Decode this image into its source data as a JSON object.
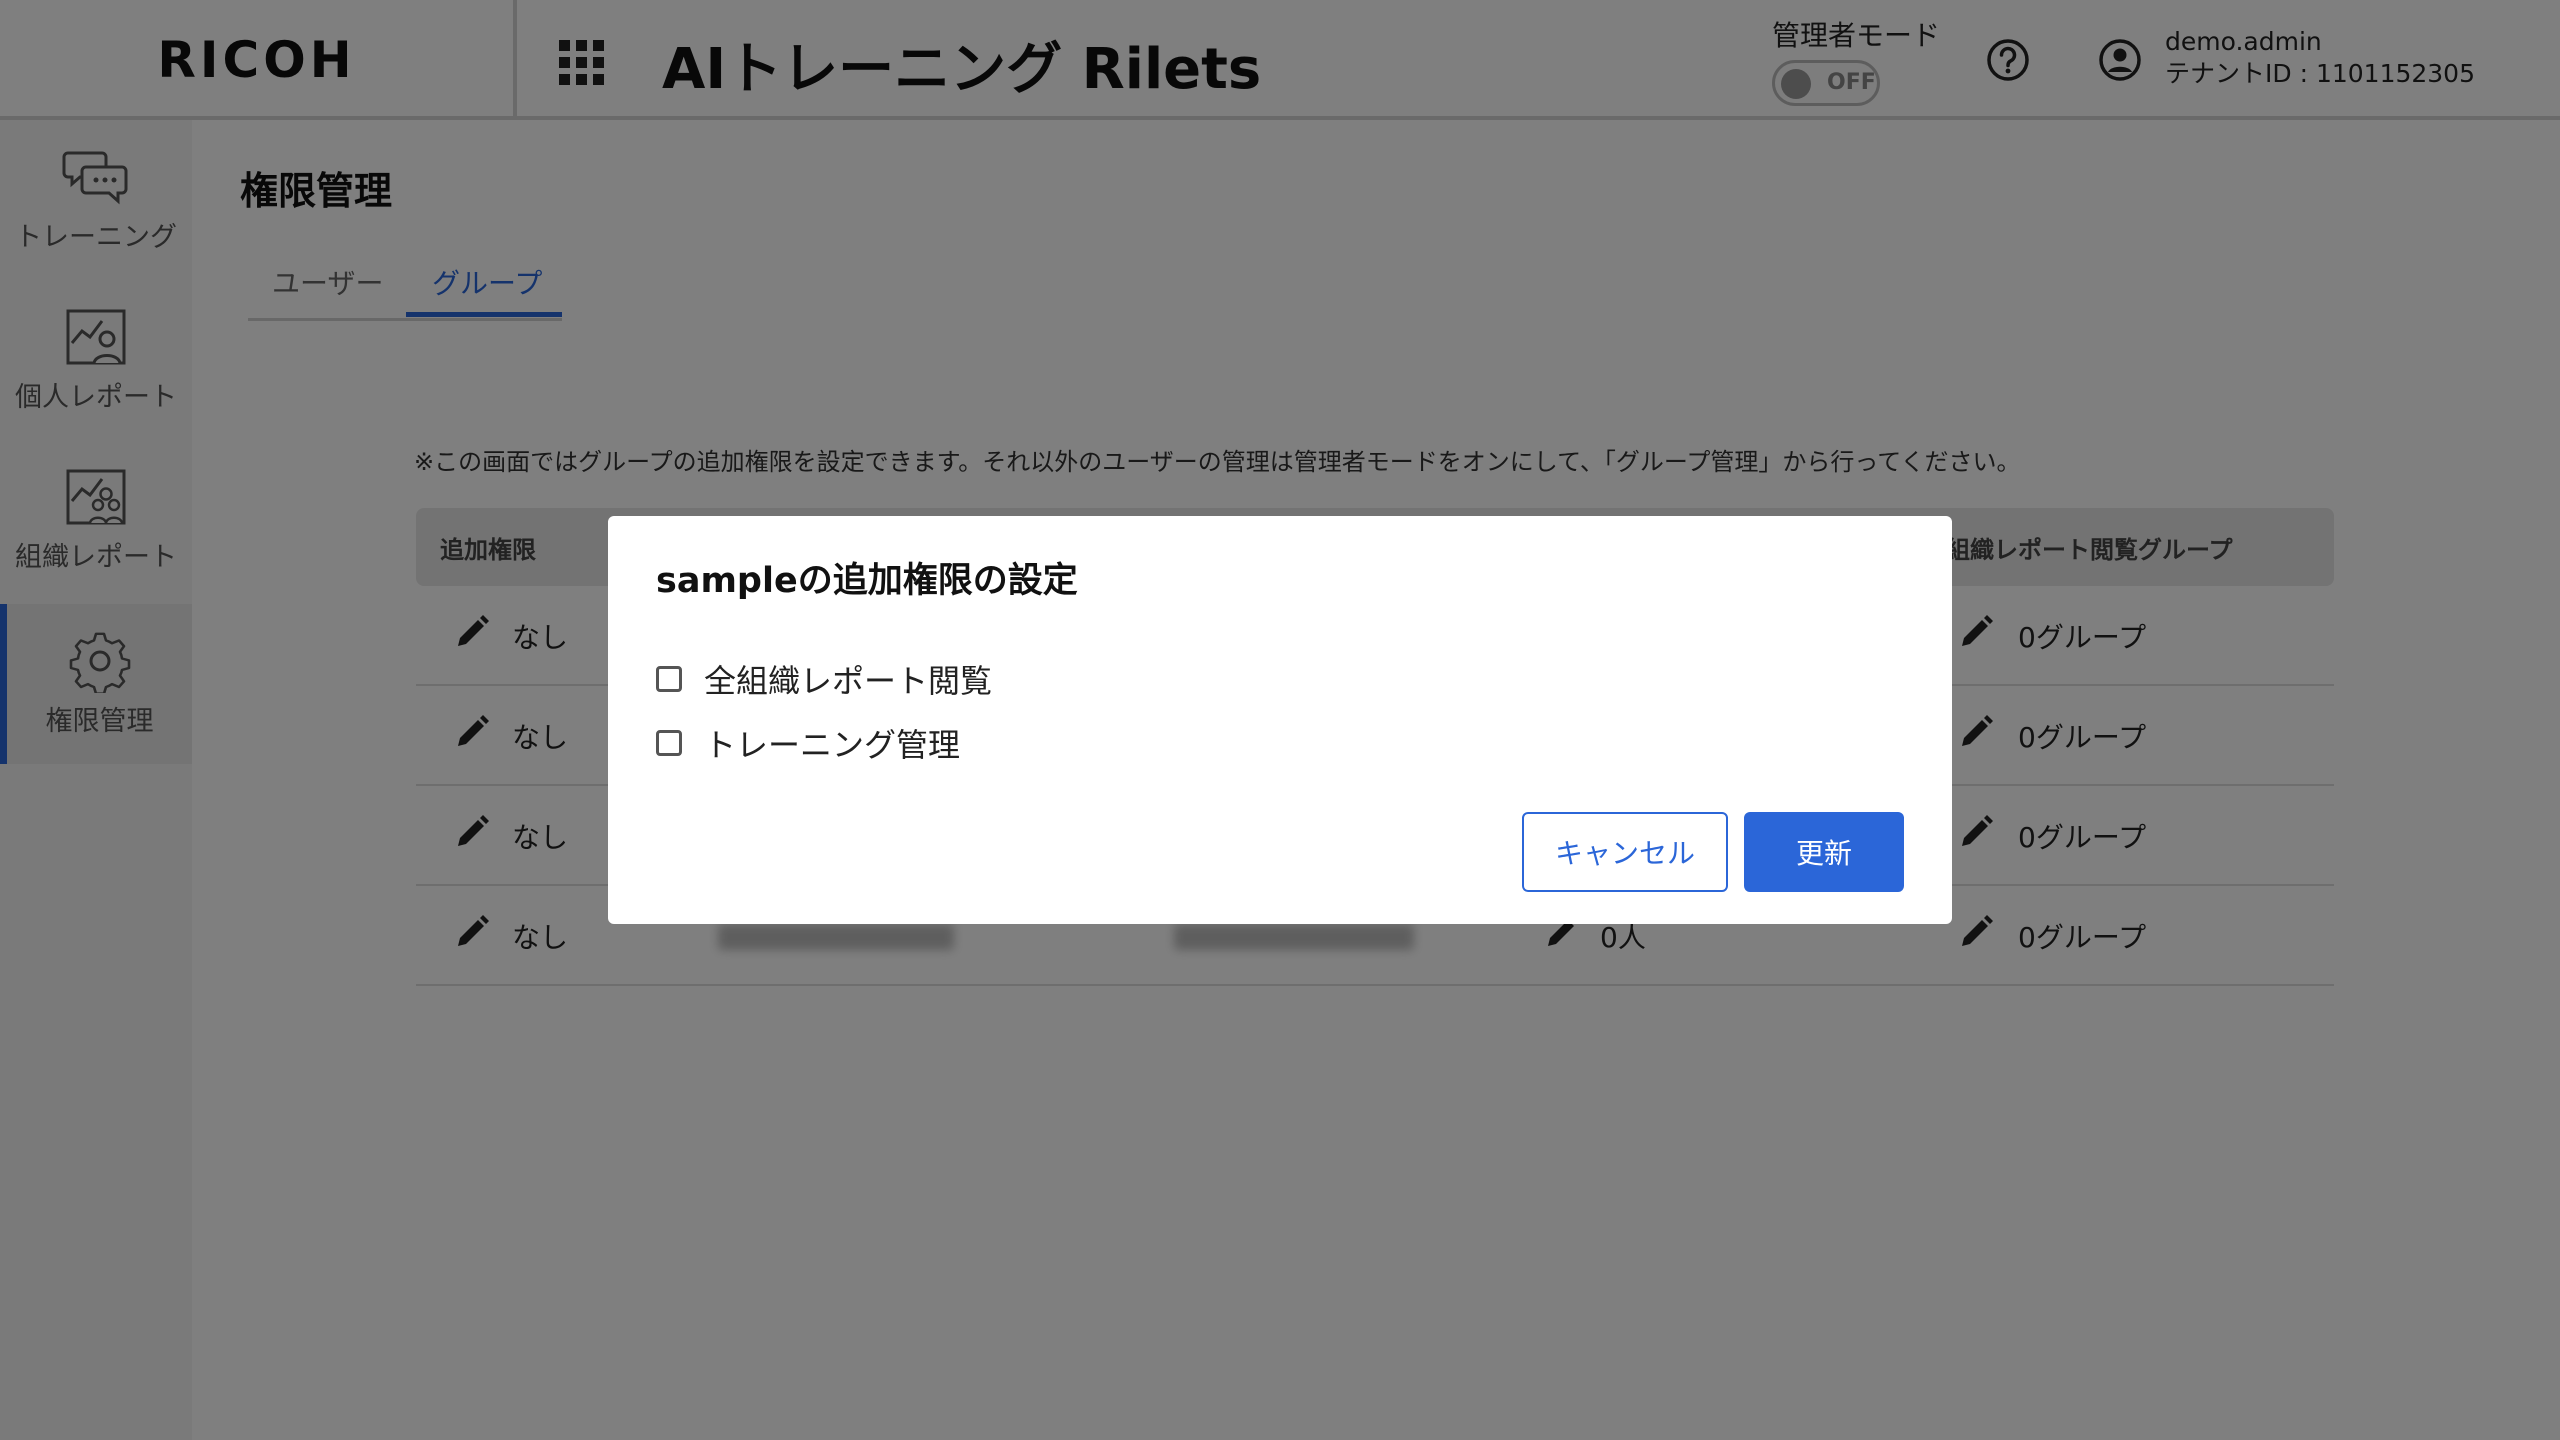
{
  "header": {
    "logo": "RICOH",
    "app_title": "AIトレーニング Rilets",
    "admin_mode_label": "管理者モード",
    "admin_toggle_text": "OFF",
    "username": "demo.admin",
    "tenant_id": "テナントID : 1101152305"
  },
  "sidebar": {
    "items": [
      {
        "label": "トレーニング",
        "icon": "chat-bubbles-icon",
        "active": false
      },
      {
        "label": "個人レポート",
        "icon": "personal-report-icon",
        "active": false
      },
      {
        "label": "組織レポート",
        "icon": "organization-report-icon",
        "active": false
      },
      {
        "label": "権限管理",
        "icon": "gear-icon",
        "active": true
      }
    ]
  },
  "main": {
    "page_title": "権限管理",
    "tabs": [
      {
        "label": "ユーザー",
        "active": false
      },
      {
        "label": "グループ",
        "active": true
      }
    ],
    "notice": "※この画面ではグループの追加権限を設定できます。それ以外のユーザーの管理は管理者モードをオンにして、「グループ管理」から行ってください。",
    "table": {
      "headers": [
        "追加権限",
        "",
        "",
        "",
        "組織レポート閲覧グループ"
      ],
      "rows": [
        {
          "permission": "なし",
          "members": "",
          "report_groups": "0グループ"
        },
        {
          "permission": "なし",
          "members": "",
          "report_groups": "0グループ"
        },
        {
          "permission": "なし",
          "members": "",
          "report_groups": "0グループ"
        },
        {
          "permission": "なし",
          "members": "0人",
          "report_groups": "0グループ"
        }
      ]
    }
  },
  "dialog": {
    "title": "sampleの追加権限の設定",
    "options": [
      {
        "label": "全組織レポート閲覧",
        "checked": false
      },
      {
        "label": "トレーニング管理",
        "checked": false
      }
    ],
    "cancel_label": "キャンセル",
    "update_label": "更新"
  },
  "colors": {
    "accent": "#2b66d8",
    "overlay": "rgba(0,0,0,0.5)"
  }
}
